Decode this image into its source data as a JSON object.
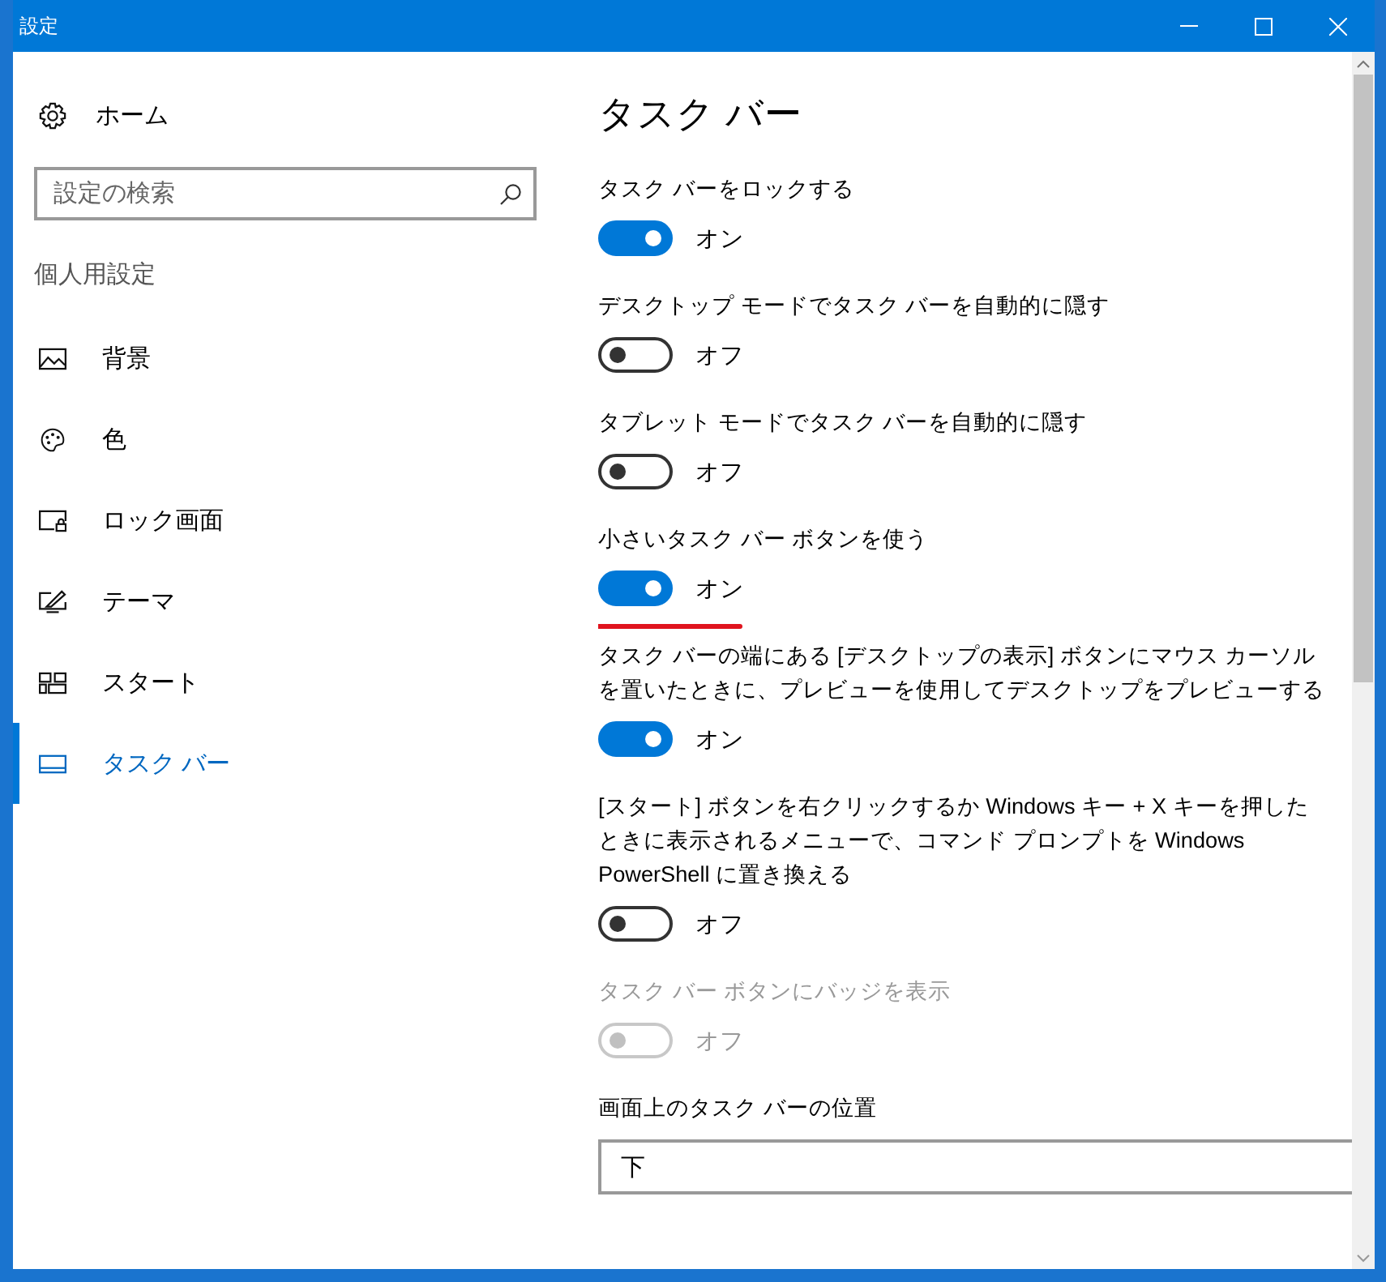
{
  "window": {
    "title": "設定"
  },
  "sidebar": {
    "home": "ホーム",
    "search": {
      "placeholder": "設定の検索"
    },
    "section": "個人用設定",
    "items": [
      {
        "label": "背景",
        "selected": false
      },
      {
        "label": "色",
        "selected": false
      },
      {
        "label": "ロック画面",
        "selected": false
      },
      {
        "label": "テーマ",
        "selected": false
      },
      {
        "label": "スタート",
        "selected": false
      },
      {
        "label": "タスク バー",
        "selected": true
      }
    ]
  },
  "main": {
    "title": "タスク バー",
    "settings": [
      {
        "label": "タスク バーをロックする",
        "on": true,
        "state": "オン",
        "disabled": false,
        "underlined": false
      },
      {
        "label": "デスクトップ モードでタスク バーを自動的に隠す",
        "on": false,
        "state": "オフ",
        "disabled": false,
        "underlined": false
      },
      {
        "label": "タブレット モードでタスク バーを自動的に隠す",
        "on": false,
        "state": "オフ",
        "disabled": false,
        "underlined": false
      },
      {
        "label": "小さいタスク バー ボタンを使う",
        "on": true,
        "state": "オン",
        "disabled": false,
        "underlined": true
      },
      {
        "label": "タスク バーの端にある [デスクトップの表示] ボタンにマウス カーソルを置いたときに、プレビューを使用してデスクトップをプレビューする",
        "on": true,
        "state": "オン",
        "disabled": false,
        "underlined": false
      },
      {
        "label": "[スタート] ボタンを右クリックするか Windows キー + X キーを押したときに表示されるメニューで、コマンド プロンプトを Windows PowerShell に置き換える",
        "on": false,
        "state": "オフ",
        "disabled": false,
        "underlined": false
      },
      {
        "label": "タスク バー ボタンにバッジを表示",
        "on": false,
        "state": "オフ",
        "disabled": true,
        "underlined": false
      }
    ],
    "position": {
      "label": "画面上のタスク バーの位置",
      "value": "下"
    }
  }
}
